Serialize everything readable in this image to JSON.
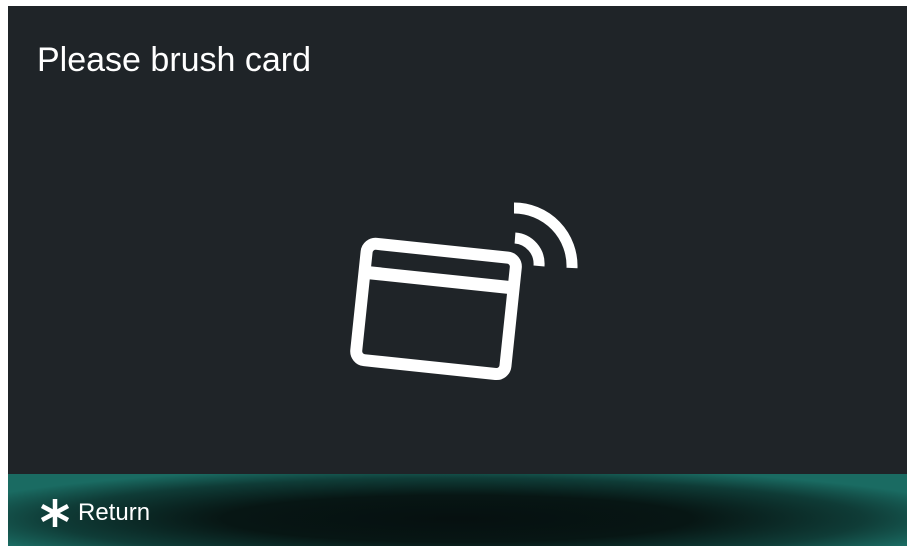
{
  "screen": {
    "title": "Please brush card",
    "icon": "contactless-card-icon"
  },
  "footer": {
    "return_icon": "asterisk-icon",
    "return_label": "Return"
  },
  "colors": {
    "background": "#1f2428",
    "foreground": "#ffffff",
    "footer_accent": "#1a6b62"
  }
}
